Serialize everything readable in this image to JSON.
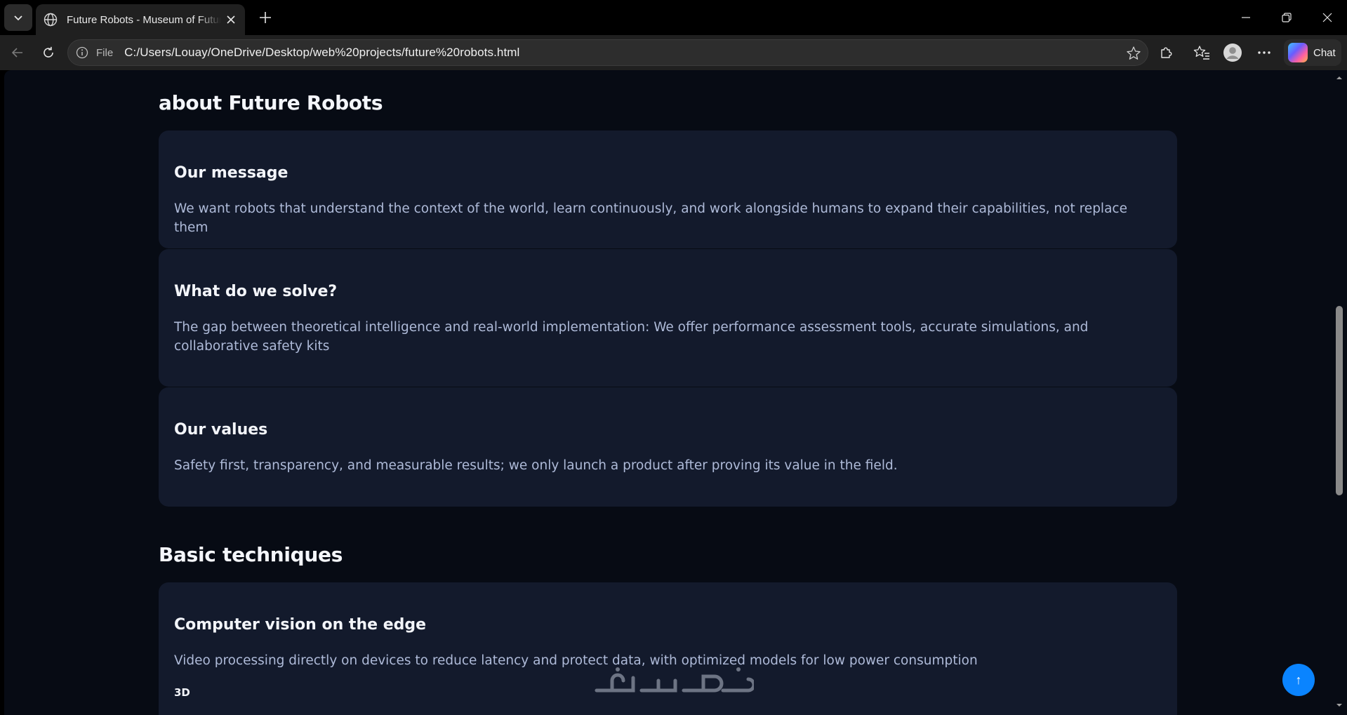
{
  "browser": {
    "tab_title": "Future Robots - Museum of Future Robots",
    "address_scheme": "File",
    "address_url": "C:/Users/Louay/OneDrive/Desktop/web%20projects/future%20robots.html",
    "chat_label": "Chat"
  },
  "page": {
    "about_title": "about Future Robots",
    "about_cards": [
      {
        "title": "Our message",
        "body": "We want robots that understand the context of the world, learn continuously, and work alongside humans to expand their capabilities, not replace them"
      },
      {
        "title": "What do we solve?",
        "body": "The gap between theoretical intelligence and real-world implementation: We offer performance assessment tools, accurate simulations, and collaborative safety kits"
      },
      {
        "title": "Our values",
        "body": "Safety first, transparency, and measurable results; we only launch a product after proving its value in the field."
      }
    ],
    "techniques_title": "Basic techniques",
    "technique_cards": [
      {
        "title": "Computer vision on the edge",
        "body": "Video processing directly on devices to reduce latency and protect data, with optimized models for low power consumption",
        "tag": "3D"
      }
    ],
    "back_to_top_symbol": "↑"
  },
  "colors": {
    "page_background": "#070b14",
    "card_background": "#131a2c",
    "accent_button": "#0a84ff"
  },
  "icons": [
    "tab-list-icon",
    "globe-icon",
    "close-icon",
    "plus-icon",
    "minimize-icon",
    "restore-icon",
    "window-close-icon",
    "back-arrow-icon",
    "reload-icon",
    "info-icon",
    "favorite-star-icon",
    "extensions-icon",
    "favorites-icon",
    "profile-avatar-icon",
    "more-icon",
    "copilot-icon",
    "arrow-up-icon"
  ]
}
